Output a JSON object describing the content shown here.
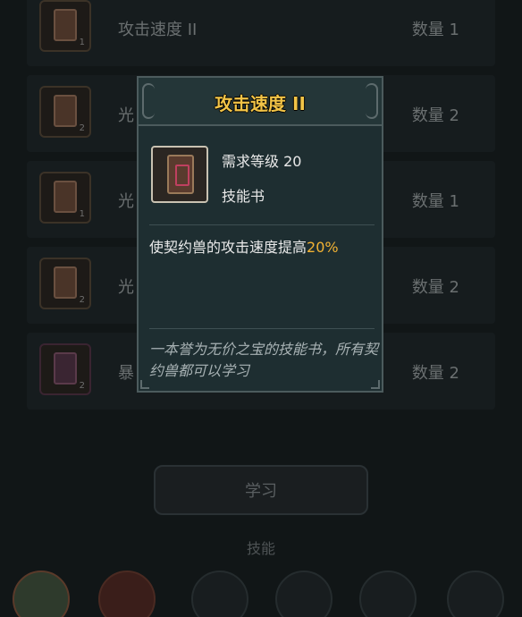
{
  "list": {
    "rows": [
      {
        "name": "攻击速度 II",
        "qty": "数量 1",
        "num": "1"
      },
      {
        "name": "光",
        "qty": "数量 2",
        "num": "2"
      },
      {
        "name": "光",
        "qty": "数量 1",
        "num": "1"
      },
      {
        "name": "光",
        "qty": "数量 2",
        "num": "2"
      },
      {
        "name": "暴",
        "qty": "数量 2",
        "num": "2"
      }
    ]
  },
  "learn_button": "学习",
  "skills_tab": "技能",
  "modal": {
    "title": "攻击速度 II",
    "required_level": "需求等级 20",
    "item_type": "技能书",
    "effect_text": "使契约兽的攻击速度提高",
    "effect_value": "20%",
    "flavor_text": "一本誉为无价之宝的技能书，所有契约兽都可以学习"
  },
  "colors": {
    "title": "#f2c447",
    "highlight": "#f2b233"
  },
  "icons": {
    "item": "skill-book-icon",
    "bottom_bar": [
      "pet-avatar-icon",
      "fire-skill-icon",
      "locked-skill-icon",
      "locked-skill-icon",
      "lock-icon",
      "lock-icon"
    ]
  }
}
